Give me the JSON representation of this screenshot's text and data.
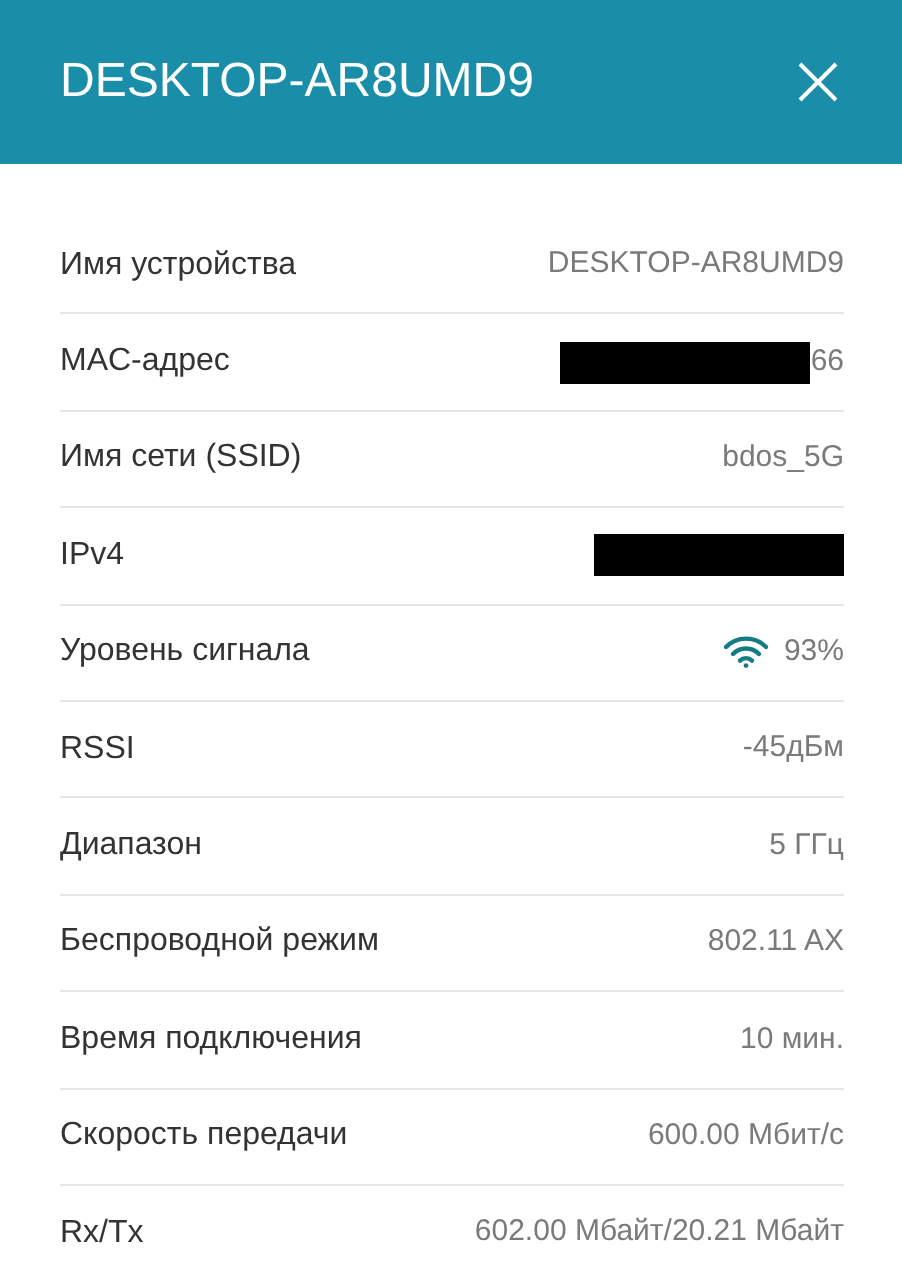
{
  "header": {
    "title": "DESKTOP-AR8UMD9"
  },
  "rows": [
    {
      "label": "Имя устройства",
      "value": "DESKTOP-AR8UMD9",
      "kind": "text",
      "redacted": false
    },
    {
      "label": "MAC-адрес",
      "value": "66",
      "kind": "text",
      "redacted": true
    },
    {
      "label": "Имя сети (SSID)",
      "value": "bdos_5G",
      "kind": "text",
      "redacted": false
    },
    {
      "label": "IPv4",
      "kind": "text",
      "redacted": true
    },
    {
      "label": "Уровень сигнала",
      "value": "93%",
      "kind": "signal",
      "redacted": false
    },
    {
      "label": "RSSI",
      "value": "-45дБм",
      "kind": "text",
      "redacted": false
    },
    {
      "label": "Диапазон",
      "value": "5 ГГц",
      "kind": "text",
      "redacted": false
    },
    {
      "label": "Беспроводной режим",
      "value": "802.11 AX",
      "kind": "text",
      "redacted": false
    },
    {
      "label": "Время подключения",
      "value": "10 мин.",
      "kind": "text",
      "redacted": false
    },
    {
      "label": "Скорость передачи",
      "value": "600.00 Мбит/с",
      "kind": "text",
      "redacted": false
    },
    {
      "label": "Rx/Tx",
      "value": "602.00 Мбайт/20.21 Мбайт",
      "kind": "text",
      "redacted": false
    }
  ]
}
